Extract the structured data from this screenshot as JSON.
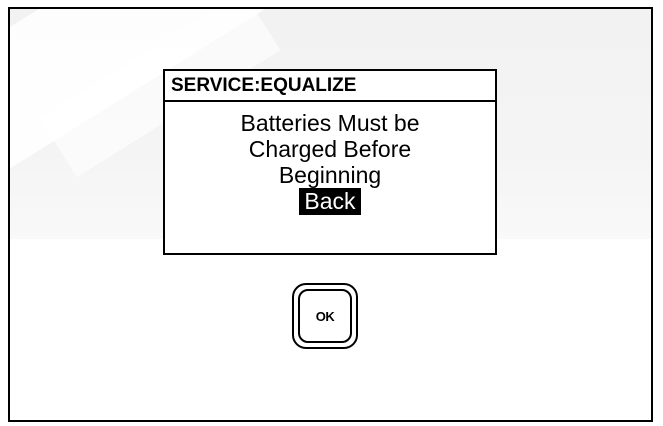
{
  "dialog": {
    "title": "SERVICE:EQUALIZE",
    "message_lines": [
      "Batteries Must be",
      "Charged Before",
      "Beginning"
    ],
    "back_label": "Back"
  },
  "ok_button": {
    "label": "OK"
  },
  "colors": {
    "border": "#000000",
    "background": "#ffffff",
    "highlight_bg": "#000000",
    "highlight_text": "#ffffff"
  }
}
